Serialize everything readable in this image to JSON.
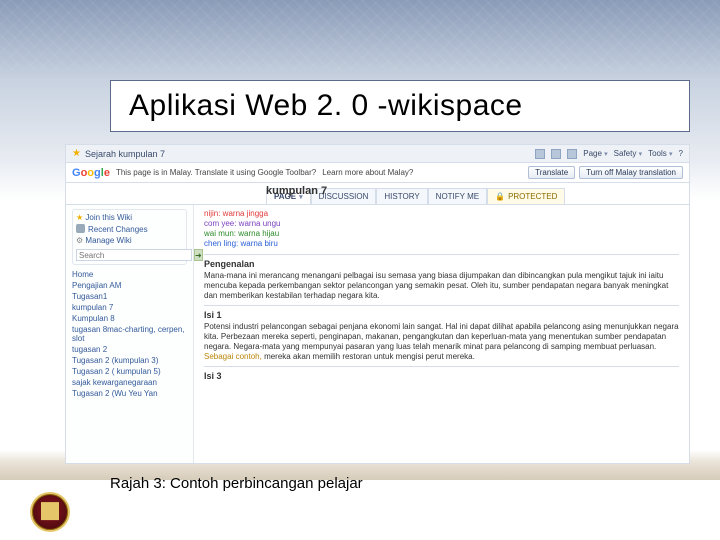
{
  "slide": {
    "title": "Aplikasi Web 2. 0 -wikispace",
    "caption": "Rajah 3: Contoh perbincangan pelajar"
  },
  "ie_toolbar": {
    "favorite_label": "Sejarah kumpulan 7",
    "menu": {
      "page": "Page",
      "safety": "Safety",
      "tools": "Tools"
    }
  },
  "google_bar": {
    "message": "This page is in Malay. Translate it using Google Toolbar?",
    "learn": "Learn more about Malay?",
    "translate": "Translate",
    "turn_off": "Turn off Malay translation"
  },
  "wiki": {
    "title": "kumpulan 7",
    "tabs": {
      "page": "PAGE",
      "discussion": "DISCUSSION",
      "history": "HISTORY",
      "notify": "NOTIFY ME",
      "protected": "PROTECTED"
    },
    "sidebar": {
      "join": "Join this Wiki",
      "recent": "Recent Changes",
      "manage": "Manage Wiki",
      "search_placeholder": "Search",
      "items": [
        "Home",
        "Pengajian AM",
        "Tugasan1",
        "kumpulan 7",
        "Kumpulan 8",
        "tugasan 8mac-charting, cerpen, slot",
        "tugasan 2",
        "Tugasan 2 (kumpulan 3)",
        "Tugasan 2 ( kumpulan 5)",
        "sajak kewarganegaraan",
        "Tugasan 2 (Wu Yeu Yan"
      ]
    },
    "content": {
      "color_lines": [
        "nijin: warna jingga",
        "com yee: warna ungu",
        "wai mun: warna hijau",
        "chen ling: warna biru"
      ],
      "heading1": "Pengenalan",
      "para1": "Mana-mana ini merancang menangani pelbagai isu semasa yang biasa dijumpakan dan dibincangkan pula mengikut tajuk ini iaitu mencuba kepada perkembangan sektor pelancongan yang semakin pesat. Oleh itu, sumber pendapatan negara banyak meningkat dan memberikan kestabilan terhadap negara kita.",
      "heading2": "Isi 1",
      "para2_a": "Potensi industri pelancongan sebagai penjana ekonomi lain sangat. Hal ini dapat dilihat apabila pelancong asing menunjukkan negara kita. Perbezaan mereka seperti, penginapan, makanan, pengangkutan dan keperluan-mata yang menentukan sumber pendapatan negara. Negara-mata yang mempunyai pasaran yang luas telah menarik minat para pelancong di samping membuat perluasan.",
      "para2_b": "Sebagai contoh,",
      "para2_c": "mereka akan memilih restoran untuk mengisi perut mereka.",
      "heading3": "Isi 3"
    }
  }
}
